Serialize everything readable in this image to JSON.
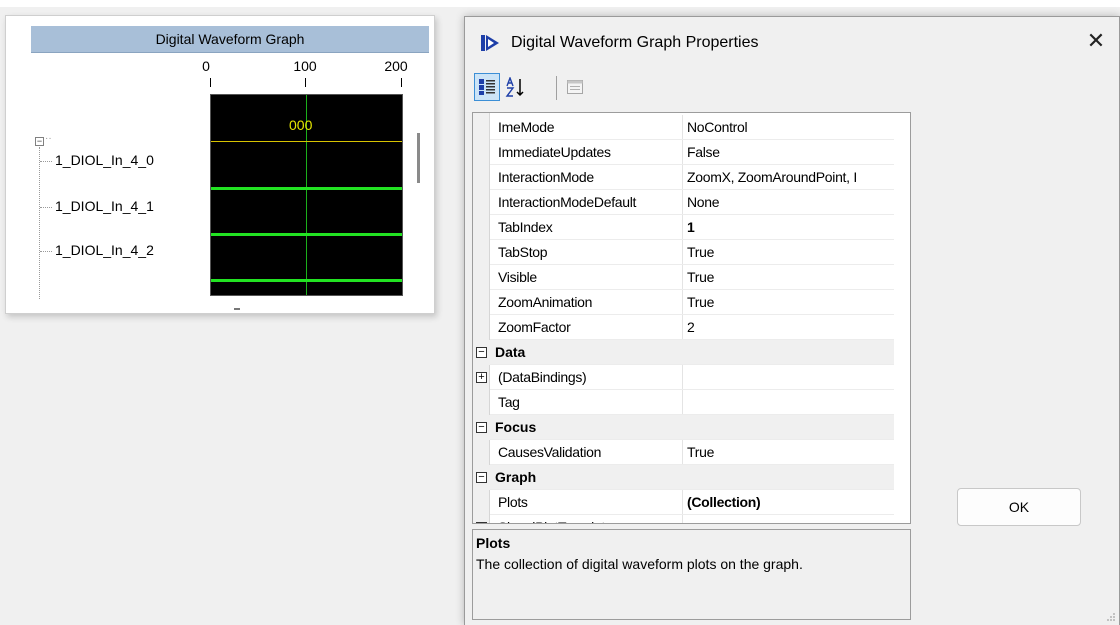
{
  "graph": {
    "title": "Digital Waveform Graph",
    "axis_ticks": [
      "0",
      "100",
      "200"
    ],
    "bus_value": "000",
    "signals": [
      "1_DIOL_In_4_0",
      "1_DIOL_In_4_1",
      "1_DIOL_In_4_2"
    ],
    "bottom_mark": "-",
    "colors": {
      "title_bg": "#a8bfd8",
      "plot_bg": "#000000",
      "signal": "#22e322",
      "bus": "#d7c300"
    }
  },
  "dialog": {
    "title": "Digital Waveform Graph Properties",
    "close_glyph": "✕",
    "toolbar": {
      "categorized_icon": "categorized-icon",
      "alphabetical_icon": "alphabetical-sort-icon",
      "property_pages_icon": "property-pages-icon"
    },
    "rows": [
      {
        "type": "prop",
        "name": "ImeMode",
        "value": "NoControl"
      },
      {
        "type": "prop",
        "name": "ImmediateUpdates",
        "value": "False"
      },
      {
        "type": "prop",
        "name": "InteractionMode",
        "value": "ZoomX, ZoomAroundPoint, I"
      },
      {
        "type": "prop",
        "name": "InteractionModeDefault",
        "value": "None"
      },
      {
        "type": "prop",
        "name": "TabIndex",
        "value": "1",
        "bold": true
      },
      {
        "type": "prop",
        "name": "TabStop",
        "value": "True"
      },
      {
        "type": "prop",
        "name": "Visible",
        "value": "True"
      },
      {
        "type": "prop",
        "name": "ZoomAnimation",
        "value": "True"
      },
      {
        "type": "prop",
        "name": "ZoomFactor",
        "value": "2"
      },
      {
        "type": "category",
        "name": "Data",
        "glyph": "−"
      },
      {
        "type": "prop",
        "name": "(DataBindings)",
        "value": "",
        "expander": "+"
      },
      {
        "type": "prop",
        "name": "Tag",
        "value": ""
      },
      {
        "type": "category",
        "name": "Focus",
        "glyph": "−"
      },
      {
        "type": "prop",
        "name": "CausesValidation",
        "value": "True"
      },
      {
        "type": "category",
        "name": "Graph",
        "glyph": "−"
      },
      {
        "type": "prop",
        "name": "Plots",
        "value": "(Collection)",
        "bold": true
      },
      {
        "type": "prop",
        "name": "SignalPlotTemplate",
        "value": "",
        "expander": "+"
      }
    ],
    "description": {
      "title": "Plots",
      "text": "The collection of digital waveform plots on the graph."
    },
    "ok_label": "OK",
    "colors": {
      "accent": "#3c8fd6",
      "toolbar_active": "#cce4f7",
      "icon": "#1e3fa8"
    }
  }
}
